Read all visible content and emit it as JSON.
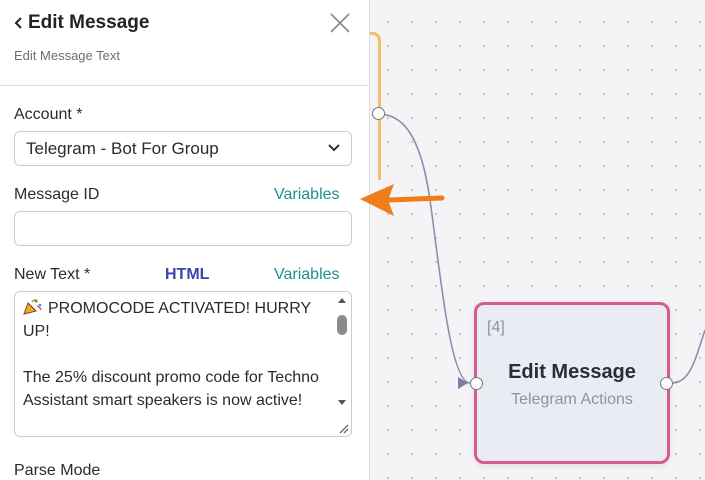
{
  "panel": {
    "title": "Edit Message",
    "subtitle": "Edit Message Text",
    "account_label": "Account *",
    "account_value": "Telegram - Bot For Group",
    "message_id_label": "Message ID",
    "message_id_variables": "Variables",
    "message_id_value": "",
    "new_text_label": "New Text *",
    "new_text_html": "HTML",
    "new_text_variables": "Variables",
    "new_text_value": "PROMOCODE ACTIVATED! HURRY UP!\n\nThe 25% discount promo code for Techno Assistant smart speakers is now active!",
    "parse_mode_label": "Parse Mode"
  },
  "node": {
    "index": "[4]",
    "title": "Edit Message",
    "subtitle": "Telegram Actions"
  },
  "colors": {
    "node_border": "#d65a8c",
    "variables_link": "#1f8f94",
    "html_link": "#3a47a8",
    "annotation_arrow": "#f07c1a",
    "orange_edge": "#f3c06a"
  },
  "icons": [
    "back-chevron-icon",
    "close-icon",
    "chevron-down-icon",
    "party-popper-icon",
    "resize-handle-icon"
  ]
}
